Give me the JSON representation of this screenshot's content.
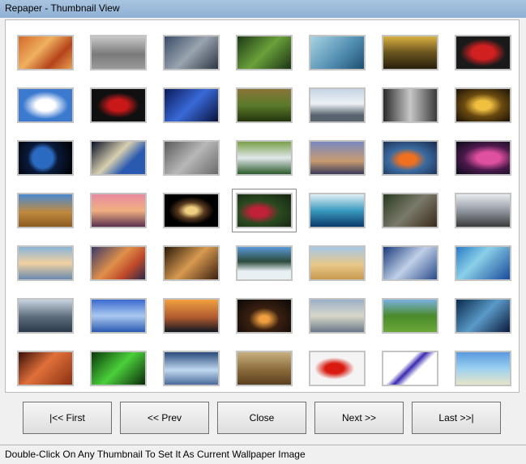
{
  "window": {
    "title": "Repaper - Thumbnail View"
  },
  "thumbnails": [
    {
      "name": "sand-dunes",
      "bg": "linear-gradient(135deg,#d36a2a,#f0b060 40%,#b4431a 70%,#e8a050)"
    },
    {
      "name": "stealth-bomber",
      "bg": "linear-gradient(#c8c8c8,#7a7a7a 55%,#9a9a9a)"
    },
    {
      "name": "fighter-jets",
      "bg": "linear-gradient(135deg,#3a4c66,#9aa4b0 50%,#2c3644)"
    },
    {
      "name": "green-leaf-drops",
      "bg": "linear-gradient(135deg,#1e3a16,#6aa03a 50%,#1c3414)"
    },
    {
      "name": "dna-helix",
      "bg": "linear-gradient(135deg,#a8d4e4,#4e8aae 60%,#1e4e70)"
    },
    {
      "name": "forest-sunlight",
      "bg": "linear-gradient(#d8b040,#6a5420 50%,#28200c)"
    },
    {
      "name": "red-sports-car",
      "bg": "radial-gradient(ellipse at center,#d02020 0 30%,#1a1a1a 60%)"
    },
    {
      "name": "clouds-blue-sky",
      "bg": "radial-gradient(ellipse at center,#ffffff 0 25%,#3c7ad0 60%)"
    },
    {
      "name": "red-car-black",
      "bg": "radial-gradient(ellipse at center,#c81818 0 25%,#101010 55%)"
    },
    {
      "name": "blue-matrix",
      "bg": "linear-gradient(135deg,#0a1a5a,#3a6ad8 50%,#08123c)"
    },
    {
      "name": "jungle-waterfall",
      "bg": "linear-gradient(#8a7438,#5a7a2a 50%,#24340c)"
    },
    {
      "name": "snowy-mountains",
      "bg": "linear-gradient(#c4d4e4,#eef2f6 45%,#5a6470 80%)"
    },
    {
      "name": "forest-rays",
      "bg": "linear-gradient(90deg,#2a2a2a,#c8c8c8 50%,#3a3a3a)"
    },
    {
      "name": "cave-lights",
      "bg": "radial-gradient(ellipse at center,#f0c040 0 20%,#6a4a10 50%,#1a1206)"
    },
    {
      "name": "earth-globe",
      "bg": "radial-gradient(circle at 45% 50%,#2a6ac0 0 30%,#0a1a3a 45%,#000000)"
    },
    {
      "name": "space-capsule",
      "bg": "linear-gradient(135deg,#0a1028,#d8d0b0 45%,#2a5ab0 70%)"
    },
    {
      "name": "owl-gray",
      "bg": "linear-gradient(135deg,#5a5a5a,#b8b8b8 50%,#6a6a6a)"
    },
    {
      "name": "tropical-waterfall",
      "bg": "linear-gradient(#7aa04a,#e0e8ea 50%,#2c5a2a)"
    },
    {
      "name": "tall-ship-sunset",
      "bg": "linear-gradient(#7a8ac0,#c89a70 60%,#3a3a5a)"
    },
    {
      "name": "clownfish",
      "bg": "radial-gradient(ellipse at 45% 55%,#f07020 0 20%,#3a6aa0 45%,#1a2a4a)"
    },
    {
      "name": "nebula-pink",
      "bg": "radial-gradient(ellipse at 60% 50%,#e050a0 0 25%,#4a1a4a 55%,#0a0a1a)"
    },
    {
      "name": "roman-aqueduct",
      "bg": "linear-gradient(#4a8ad0,#c08a40 55%,#8a5a20)"
    },
    {
      "name": "sunset-sea-stacks",
      "bg": "linear-gradient(#e88aa0,#f0b080 50%,#5a3050)"
    },
    {
      "name": "spiral-galaxy",
      "bg": "radial-gradient(ellipse at center,#f0d080 0 15%,#5a3a20 35%,#000000 60%)"
    },
    {
      "name": "red-berries-leaves",
      "bg": "radial-gradient(ellipse at 40% 55%,#c0203a 0 18%,#2a4a20 45%,#142410)"
    },
    {
      "name": "ocean-wave",
      "bg": "linear-gradient(#e0f0f4,#3a9ac0 50%,#0a3a6a)"
    },
    {
      "name": "temple-tree-roots",
      "bg": "linear-gradient(135deg,#2a3a20,#7a7a6a 50%,#3a2a1a)"
    },
    {
      "name": "silver-porsche",
      "bg": "linear-gradient(#e8ecf0,#8a9098 55%,#3a3a3a)"
    },
    {
      "name": "blurred-horizon",
      "bg": "linear-gradient(#8ab4d8,#f0d0a0 50%,#6a8ab0)"
    },
    {
      "name": "orange-nebula",
      "bg": "linear-gradient(135deg,#3a3a6a,#e0904a 45%,#c04a2a 70%,#2a2a4a)"
    },
    {
      "name": "cosmic-explosion",
      "bg": "linear-gradient(135deg,#2a1a0a,#d89a50 50%,#3a2010)"
    },
    {
      "name": "snowy-lake-forest",
      "bg": "linear-gradient(#5a9ad8,#2a4a3a 45%,#e8f0f4 75%)"
    },
    {
      "name": "desert-sky",
      "bg": "linear-gradient(#a8c8e8,#e8c888 55%,#c89a50)"
    },
    {
      "name": "storm-clouds",
      "bg": "linear-gradient(135deg,#1a3a7a,#c0d0e8 50%,#2a4a8a)"
    },
    {
      "name": "coastal-aerial",
      "bg": "linear-gradient(135deg,#2a7ac8,#8ad0e8 40%,#1a4a9a)"
    },
    {
      "name": "carrier-jet",
      "bg": "linear-gradient(#c8d4e0,#5a6a7a 55%,#2a3a4a)"
    },
    {
      "name": "jets-formation",
      "bg": "linear-gradient(#3a6ad0,#aac8f0 50%,#2a5ab0)"
    },
    {
      "name": "sunset-silhouettes",
      "bg": "linear-gradient(#f0a040,#b05a30 55%,#101820)"
    },
    {
      "name": "night-plane-lights",
      "bg": "radial-gradient(ellipse at 50% 60%,#f0a040 0 12%,#3a2010 40%,#0a0808)"
    },
    {
      "name": "airplane-sky",
      "bg": "linear-gradient(#9ab0c8,#d8d8c8 50%,#6a7a8a)"
    },
    {
      "name": "green-meadow",
      "bg": "linear-gradient(#7ab0e0,#4a8a2a 50%,#6aa83a)"
    },
    {
      "name": "blue-river",
      "bg": "linear-gradient(135deg,#0a2a4a,#5a9ac8 50%,#0a1a3a)"
    },
    {
      "name": "antelope-canyon",
      "bg": "linear-gradient(135deg,#3a1008,#e0703a 45%,#8a3010)"
    },
    {
      "name": "green-aurora",
      "bg": "linear-gradient(135deg,#0a3a0a,#4ad03a 50%,#0a2a0a)"
    },
    {
      "name": "airshow-formation",
      "bg": "linear-gradient(#2a4a7a,#c0d8f0 55%,#4a6a9a)"
    },
    {
      "name": "running-wolf",
      "bg": "linear-gradient(#c8b080,#8a6a3a 55%,#5a4020)"
    },
    {
      "name": "cherry-tomatoes",
      "bg": "radial-gradient(ellipse at 45% 50%,#d81a10 0 22%,#f4f4f4 48%)"
    },
    {
      "name": "blue-abstract-curve",
      "bg": "linear-gradient(135deg,#ffffff 40%,#3a2ab0 50%,#ffffff 62%)"
    },
    {
      "name": "tropical-beach",
      "bg": "linear-gradient(#5a9ae0,#9ad0f0 50%,#e8e4c8)"
    }
  ],
  "buttons": {
    "first": "|<<  First",
    "prev": "<<  Prev",
    "close": "Close",
    "next": "Next  >>",
    "last": "Last  >>|"
  },
  "status": {
    "text": "Double-Click On Any Thumbnail To Set It As Current Wallpaper Image"
  },
  "selected_index": 24
}
